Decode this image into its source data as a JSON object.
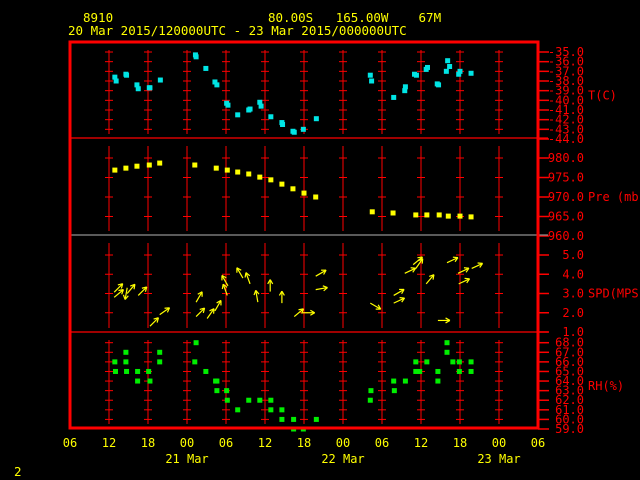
{
  "header": {
    "station": "8910",
    "location": "80.00S   165.00W    67M",
    "period": "20 Mar 2015/120000UTC - 23 Mar 2015/000000UTC"
  },
  "footer": {
    "page_number": "2"
  },
  "chart_data": {
    "type": "scatter",
    "time_origin": "20 Mar 2015 06UTC",
    "x_units": "hours since 20 Mar 06UTC",
    "xlim": [
      0,
      72
    ],
    "x_ticks": [
      "06",
      "12",
      "18",
      "00",
      "06",
      "12",
      "18",
      "00",
      "06",
      "12",
      "18",
      "00",
      "06"
    ],
    "date_labels": [
      {
        "label": "21 Mar",
        "hour": 18
      },
      {
        "label": "22 Mar",
        "hour": 42
      },
      {
        "label": "23 Mar",
        "hour": 66
      }
    ],
    "colors": {
      "frame": "#ff0000",
      "text": "#ffff00",
      "temp": "#00e5e5",
      "pres": "#ffff00",
      "wind": "#ffff00",
      "rh": "#00ee00",
      "grid_alt": "#909090"
    },
    "panels": [
      {
        "name": "temperature",
        "label": "T(C)",
        "ylim": [
          -44,
          -35
        ],
        "ticks": [
          "-35.0",
          "-36.0",
          "-37.0",
          "-38.0",
          "-39.0",
          "-40.0",
          "-41.0",
          "-42.0",
          "-43.0",
          "-44.0"
        ],
        "points": [
          [
            6.9,
            -37.6
          ],
          [
            7.1,
            -38.0
          ],
          [
            8.6,
            -37.3
          ],
          [
            8.7,
            -37.4
          ],
          [
            10.3,
            -38.4
          ],
          [
            10.5,
            -38.8
          ],
          [
            12.2,
            -38.7
          ],
          [
            12.3,
            -38.7
          ],
          [
            13.9,
            -37.9
          ],
          [
            19.3,
            -35.3
          ],
          [
            19.4,
            -35.5
          ],
          [
            20.9,
            -36.7
          ],
          [
            22.3,
            -38.1
          ],
          [
            22.6,
            -38.4
          ],
          [
            24.1,
            -40.3
          ],
          [
            24.3,
            -40.5
          ],
          [
            25.8,
            -41.5
          ],
          [
            27.5,
            -41.0
          ],
          [
            27.7,
            -40.9
          ],
          [
            29.2,
            -40.2
          ],
          [
            29.4,
            -40.6
          ],
          [
            30.9,
            -41.7
          ],
          [
            32.6,
            -42.3
          ],
          [
            32.7,
            -42.5
          ],
          [
            34.3,
            -43.2
          ],
          [
            34.5,
            -43.3
          ],
          [
            35.9,
            -43.0
          ],
          [
            37.9,
            -41.9
          ],
          [
            46.2,
            -37.4
          ],
          [
            46.4,
            -38.0
          ],
          [
            49.8,
            -39.7
          ],
          [
            51.5,
            -39.0
          ],
          [
            51.6,
            -38.6
          ],
          [
            53.0,
            -37.3
          ],
          [
            53.3,
            -37.4
          ],
          [
            54.8,
            -36.8
          ],
          [
            55.0,
            -36.6
          ],
          [
            56.5,
            -38.3
          ],
          [
            56.7,
            -38.4
          ],
          [
            58.1,
            -35.9
          ],
          [
            58.4,
            -36.5
          ],
          [
            57.9,
            -37.0
          ],
          [
            59.8,
            -37.3
          ],
          [
            60.0,
            -37.0
          ],
          [
            61.7,
            -37.2
          ]
        ]
      },
      {
        "name": "pressure",
        "label": "Pre (mb)",
        "ylim": [
          960,
          980
        ],
        "ticks": [
          "980.0",
          "975.0",
          "970.0",
          "965.0",
          "960.0"
        ],
        "points": [
          [
            6.9,
            976.9
          ],
          [
            8.6,
            977.4
          ],
          [
            10.3,
            977.9
          ],
          [
            12.2,
            978.2
          ],
          [
            13.8,
            978.7
          ],
          [
            19.2,
            978.2
          ],
          [
            22.5,
            977.4
          ],
          [
            24.2,
            976.9
          ],
          [
            25.8,
            976.4
          ],
          [
            27.5,
            975.9
          ],
          [
            29.2,
            975.1
          ],
          [
            30.9,
            974.4
          ],
          [
            32.6,
            973.3
          ],
          [
            34.3,
            972.1
          ],
          [
            36.0,
            971.0
          ],
          [
            37.8,
            970.0
          ],
          [
            46.5,
            966.2
          ],
          [
            49.7,
            965.9
          ],
          [
            53.2,
            965.4
          ],
          [
            54.9,
            965.4
          ],
          [
            56.8,
            965.4
          ],
          [
            58.2,
            965.1
          ],
          [
            60.0,
            965.1
          ],
          [
            61.7,
            964.9
          ]
        ]
      },
      {
        "name": "wind_speed",
        "label": "SPD(MPS)",
        "ylim": [
          1,
          5
        ],
        "ticks": [
          "5.0",
          "4.0",
          "3.0",
          "2.0",
          "1.0"
        ],
        "points": [
          [
            6.8,
            3.07,
            45
          ],
          [
            6.8,
            2.8,
            50
          ],
          [
            8.8,
            3.3,
            190
          ],
          [
            8.8,
            3.0,
            40
          ],
          [
            10.5,
            2.9,
            45
          ],
          [
            13.8,
            1.9,
            55
          ],
          [
            12.3,
            1.3,
            45
          ],
          [
            19.4,
            2.55,
            30
          ],
          [
            19.4,
            1.8,
            45
          ],
          [
            21.1,
            1.7,
            35
          ],
          [
            22.3,
            2.1,
            30
          ],
          [
            24.3,
            3.4,
            330
          ],
          [
            24.2,
            2.9,
            340
          ],
          [
            26.6,
            3.8,
            330
          ],
          [
            27.7,
            3.5,
            340
          ],
          [
            28.9,
            2.55,
            350
          ],
          [
            30.8,
            3.1,
            0
          ],
          [
            32.6,
            2.5,
            0
          ],
          [
            34.5,
            1.8,
            50
          ],
          [
            35.8,
            2.0,
            90
          ],
          [
            37.8,
            3.9,
            60
          ],
          [
            37.8,
            3.2,
            80
          ],
          [
            46.2,
            2.5,
            120
          ],
          [
            49.8,
            2.9,
            60
          ],
          [
            49.8,
            2.5,
            65
          ],
          [
            51.5,
            4.05,
            65
          ],
          [
            52.8,
            4.5,
            50
          ],
          [
            53.2,
            4.3,
            35
          ],
          [
            54.8,
            3.5,
            40
          ],
          [
            58.0,
            4.6,
            65
          ],
          [
            59.7,
            4.05,
            65
          ],
          [
            59.8,
            3.5,
            65
          ],
          [
            61.8,
            4.3,
            65
          ],
          [
            56.6,
            1.6,
            90
          ]
        ]
      },
      {
        "name": "relative_humidity",
        "label": "RH(%)",
        "ylim": [
          59,
          68
        ],
        "ticks": [
          "68.0",
          "67.0",
          "66.0",
          "65.0",
          "64.0",
          "63.0",
          "62.0",
          "61.0",
          "60.0",
          "59.0"
        ],
        "points": [
          [
            6.9,
            66
          ],
          [
            7.0,
            65
          ],
          [
            8.6,
            67
          ],
          [
            8.6,
            66
          ],
          [
            8.7,
            65
          ],
          [
            10.4,
            65
          ],
          [
            10.4,
            64
          ],
          [
            12.1,
            65
          ],
          [
            12.3,
            64
          ],
          [
            13.8,
            67
          ],
          [
            13.8,
            66
          ],
          [
            19.4,
            68
          ],
          [
            19.2,
            66
          ],
          [
            20.9,
            65
          ],
          [
            22.4,
            64
          ],
          [
            22.6,
            64
          ],
          [
            22.6,
            63
          ],
          [
            24.1,
            63
          ],
          [
            24.2,
            62
          ],
          [
            25.8,
            61
          ],
          [
            27.5,
            62
          ],
          [
            29.2,
            62
          ],
          [
            30.9,
            62
          ],
          [
            30.9,
            61
          ],
          [
            32.6,
            61
          ],
          [
            32.6,
            60
          ],
          [
            34.4,
            60
          ],
          [
            34.4,
            59
          ],
          [
            35.9,
            59
          ],
          [
            37.9,
            60
          ],
          [
            46.3,
            63
          ],
          [
            46.2,
            62
          ],
          [
            49.8,
            64
          ],
          [
            49.9,
            63
          ],
          [
            51.6,
            64
          ],
          [
            53.2,
            66
          ],
          [
            53.2,
            65
          ],
          [
            53.8,
            65
          ],
          [
            54.9,
            66
          ],
          [
            56.6,
            65
          ],
          [
            56.6,
            64
          ],
          [
            58.0,
            68
          ],
          [
            58.0,
            67
          ],
          [
            58.9,
            66
          ],
          [
            59.9,
            66
          ],
          [
            59.9,
            65
          ],
          [
            61.7,
            66
          ],
          [
            61.7,
            65
          ]
        ]
      }
    ]
  }
}
